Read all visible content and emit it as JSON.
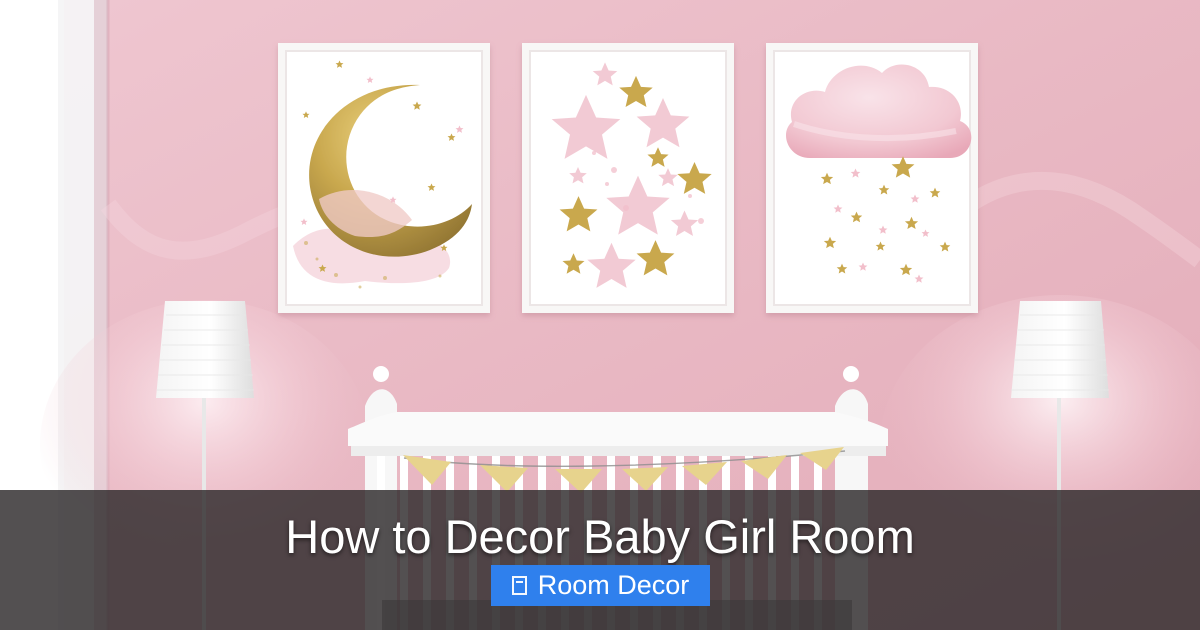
{
  "hero": {
    "title": "How to Decor Baby Girl Room",
    "category": {
      "icon": "folder-icon",
      "label": "Room Decor"
    }
  },
  "colors": {
    "wall": "#e9b9c4",
    "frame": "#f8f7f6",
    "gold": "#c9a84e",
    "pink": "#f2c8d2",
    "overlay": "#2d292b",
    "badge": "#2f80ed"
  }
}
